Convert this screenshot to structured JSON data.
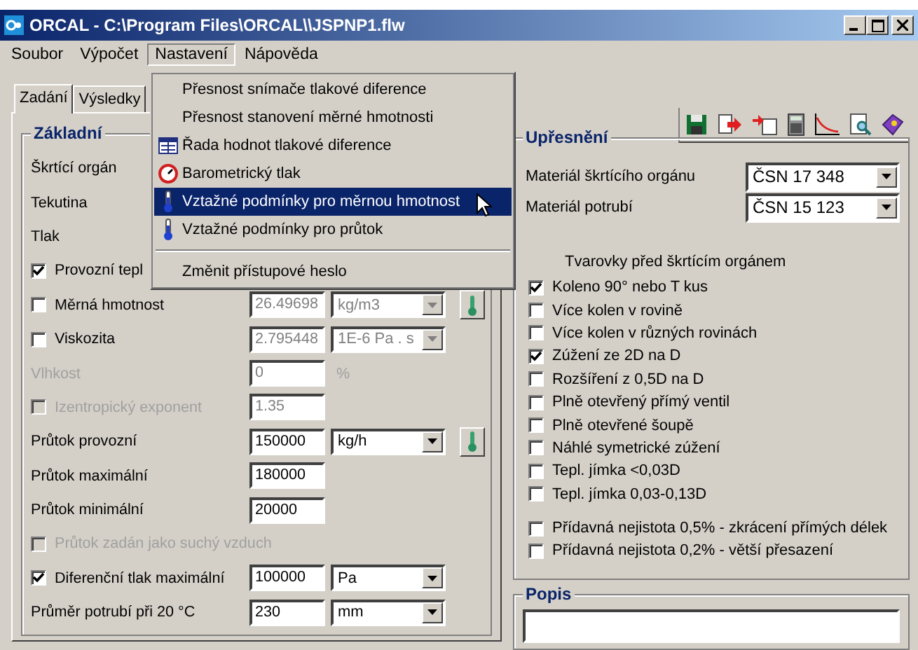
{
  "window": {
    "title": "ORCAL - C:\\Program Files\\ORCAL\\\\JSPNP1.flw"
  },
  "menubar": [
    {
      "label": "Soubor",
      "selected": false
    },
    {
      "label": "Výpočet",
      "selected": false
    },
    {
      "label": "Nastavení",
      "selected": true
    },
    {
      "label": "Nápověda",
      "selected": false
    }
  ],
  "menu": [
    {
      "kind": "plain",
      "label": "Přesnost snímače tlakové diference",
      "selected": false
    },
    {
      "kind": "plain",
      "label": "Přesnost stanovení měrné hmotnosti",
      "selected": false
    },
    {
      "kind": "table",
      "label": "Řada hodnot tlakové diference",
      "selected": false
    },
    {
      "kind": "gauge",
      "label": "Barometrický tlak",
      "selected": false
    },
    {
      "kind": "thermo",
      "label": "Vztažné podmínky pro měrnou hmotnost",
      "selected": true
    },
    {
      "kind": "thermo",
      "label": "Vztažné podmínky pro průtok",
      "selected": false
    },
    {
      "kind": "separator"
    },
    {
      "kind": "plain",
      "label": "Změnit přístupové heslo",
      "selected": false
    }
  ],
  "tabs": [
    {
      "label": "Zadání",
      "selected": true
    },
    {
      "label": "Výsledky",
      "selected": false
    }
  ],
  "basic": {
    "title": "Základní",
    "rows": [
      {
        "kind": "label",
        "label": "Škrtící orgán",
        "disabled": false,
        "button": false
      },
      {
        "kind": "label",
        "label": "Tekutina",
        "disabled": false,
        "button": false
      },
      {
        "kind": "label",
        "label": "Tlak",
        "disabled": false,
        "button": false
      },
      {
        "kind": "check",
        "label": "Provozní tepl",
        "checked": true,
        "disabled": false,
        "button": false
      },
      {
        "kind": "check",
        "label": "Měrná hmotnost",
        "checked": false,
        "disabled": false,
        "value": {
          "text": "26.49698",
          "disabled": true
        },
        "unit": {
          "kind": "select",
          "text": "kg/m3",
          "disabled": true
        },
        "button": true
      },
      {
        "kind": "check",
        "label": "Viskozita",
        "checked": false,
        "disabled": false,
        "value": {
          "text": "2.795448",
          "disabled": true
        },
        "unit": {
          "kind": "select",
          "text": "1E-6 Pa . s",
          "disabled": true
        },
        "button": false
      },
      {
        "kind": "label",
        "label": "Vlhkost",
        "disabled": true,
        "value": {
          "text": "0",
          "disabled": true
        },
        "unit": {
          "kind": "text",
          "text": "%",
          "disabled": true
        },
        "button": false
      },
      {
        "kind": "check",
        "label": "Izentropický exponent",
        "checked": false,
        "disabled": true,
        "value": {
          "text": "1.35",
          "disabled": true
        },
        "button": false
      },
      {
        "kind": "label",
        "label": "Průtok provozní",
        "disabled": false,
        "value": {
          "text": "150000",
          "disabled": false
        },
        "unit": {
          "kind": "select",
          "text": "kg/h",
          "disabled": false
        },
        "button": true
      },
      {
        "kind": "label",
        "label": "Průtok maximální",
        "disabled": false,
        "value": {
          "text": "180000",
          "disabled": false
        },
        "button": false
      },
      {
        "kind": "label",
        "label": "Průtok minimální",
        "disabled": false,
        "value": {
          "text": "20000",
          "disabled": false
        },
        "button": false
      },
      {
        "kind": "check",
        "label": "Průtok zadán jako suchý vzduch",
        "checked": false,
        "disabled": true,
        "button": false
      },
      {
        "kind": "check",
        "label": "Diferenční tlak maximální",
        "checked": true,
        "disabled": false,
        "value": {
          "text": "100000",
          "disabled": false
        },
        "unit": {
          "kind": "select",
          "text": "Pa",
          "disabled": false
        },
        "button": false
      },
      {
        "kind": "label",
        "label": "Průměr potrubí při 20 °C",
        "disabled": false,
        "value": {
          "text": "230",
          "disabled": false
        },
        "unit": {
          "kind": "select",
          "text": "mm",
          "disabled": false
        },
        "button": false
      }
    ]
  },
  "detail": {
    "title": "Upřesnění",
    "materials": [
      {
        "label": "Materiál škrtícího orgánu",
        "value": "ČSN 17 348"
      },
      {
        "label": "Materiál potrubí",
        "value": "ČSN 15 123"
      }
    ],
    "fittings_title": "Tvarovky před škrtícím orgánem",
    "fittings": [
      {
        "label": "Koleno 90° nebo T kus",
        "checked": true
      },
      {
        "label": "Více kolen v rovině",
        "checked": false
      },
      {
        "label": "Více kolen v různých rovinách",
        "checked": false
      },
      {
        "label": "Zúžení ze 2D na D",
        "checked": true
      },
      {
        "label": "Rozšíření z 0,5D na D",
        "checked": false
      },
      {
        "label": "Plně otevřený přímý ventil",
        "checked": false
      },
      {
        "label": "Plně otevřené šoupě",
        "checked": false
      },
      {
        "label": "Náhlé symetrické zúžení",
        "checked": false
      },
      {
        "label": "Tepl. jímka <0,03D",
        "checked": false
      },
      {
        "label": "Tepl. jímka 0,03-0,13D",
        "checked": false
      }
    ],
    "extras": [
      {
        "label": "Přídavná nejistota 0,5% - zkrácení přímých délek",
        "checked": false
      },
      {
        "label": "Přídavná nejistota 0,2% - větší přesazení",
        "checked": false
      }
    ]
  },
  "description": {
    "title": "Popis"
  }
}
